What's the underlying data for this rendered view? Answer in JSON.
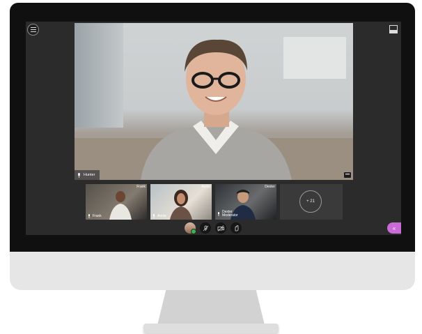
{
  "session": {
    "presenter_name": "Hunter",
    "participants": [
      {
        "name": "Frank",
        "corner_label": "Frank",
        "role": ""
      },
      {
        "name": "Annie",
        "corner_label": "Annie",
        "role": ""
      },
      {
        "name": "Dexter",
        "corner_label": "Dexter",
        "role": "Moderator"
      }
    ],
    "more_participants": "+ 21"
  },
  "colors": {
    "collaborate_panel": "#c86bd6",
    "status_online": "#3bb54a"
  },
  "icons": {
    "menu": "hamburger-menu-icon",
    "layout": "layout-toggle-icon",
    "more": "ellipsis-icon",
    "mic_off": "microphone-off-icon",
    "camera_off": "camera-off-icon",
    "hand": "raise-hand-icon",
    "panel": "double-chevron-left-icon"
  }
}
